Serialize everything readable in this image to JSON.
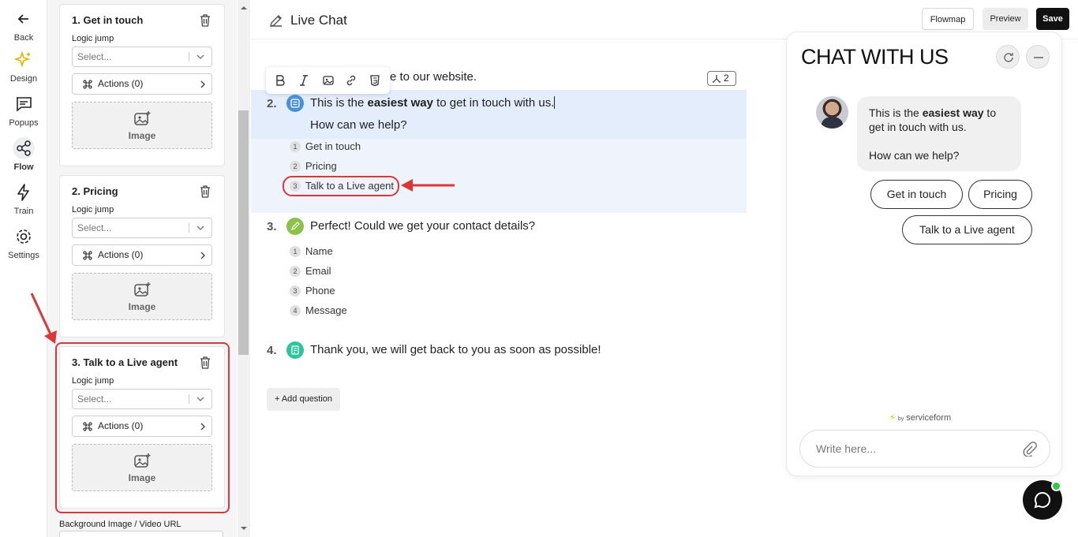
{
  "nav": {
    "back": "Back",
    "items": [
      {
        "label": "Design"
      },
      {
        "label": "Popups"
      },
      {
        "label": "Flow"
      },
      {
        "label": "Train"
      },
      {
        "label": "Settings"
      }
    ]
  },
  "panel": {
    "logic_label": "Logic jump",
    "select_placeholder": "Select...",
    "actions_label": "Actions (0)",
    "image_label": "Image",
    "cards": [
      {
        "title": "1. Get in touch"
      },
      {
        "title": "2. Pricing"
      },
      {
        "title": "3. Talk to a Live agent"
      }
    ],
    "bg_label": "Background Image / Video URL"
  },
  "header": {
    "title": "Live Chat",
    "flowmap": "Flowmap",
    "preview": "Preview",
    "save": "Save"
  },
  "editor": {
    "welcome_tail": "e to our website.",
    "badge": "2",
    "q2": {
      "num": "2.",
      "pre": "This is the ",
      "bold": "easiest way",
      "post": " to get in touch with us.",
      "line2": "How can we help?"
    },
    "q2_options": [
      {
        "n": "1",
        "label": "Get in touch"
      },
      {
        "n": "2",
        "label": "Pricing"
      },
      {
        "n": "3",
        "label": "Talk to a Live agent"
      }
    ],
    "q3": {
      "num": "3.",
      "text": "Perfect! Could we get your contact details?"
    },
    "q3_options": [
      {
        "n": "1",
        "label": "Name"
      },
      {
        "n": "2",
        "label": "Email"
      },
      {
        "n": "3",
        "label": "Phone"
      },
      {
        "n": "4",
        "label": "Message"
      }
    ],
    "q4": {
      "num": "4.",
      "text": "Thank you, we will get back to you as soon as possible!"
    },
    "add_question": "+ Add question"
  },
  "chat": {
    "title": "CHAT WITH US",
    "msg_pre": "This is the ",
    "msg_bold": "easiest way",
    "msg_post": " to get in touch with us.",
    "msg_line2": "How can we help?",
    "chips": [
      "Get in touch",
      "Pricing",
      "Talk to a Live agent"
    ],
    "powered_by": "by",
    "brand": "serviceform",
    "input_placeholder": "Write here..."
  },
  "colors": {
    "accent_red": "#d9373a",
    "q_blue": "#4a90d9",
    "q_green": "#8bc34a",
    "q_teal": "#2ec4a0",
    "online": "#2ecc40"
  }
}
